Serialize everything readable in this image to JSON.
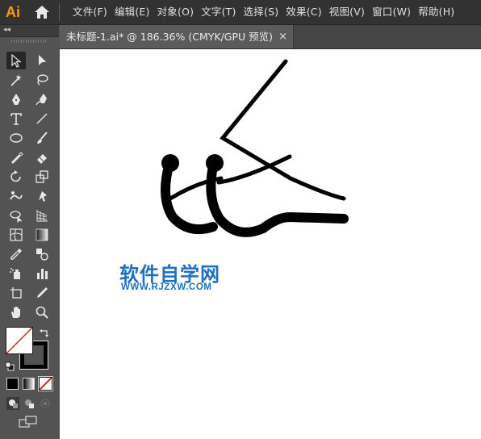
{
  "app": {
    "logo_text": "Ai"
  },
  "menu": {
    "items": [
      "文件(F)",
      "编辑(E)",
      "对象(O)",
      "文字(T)",
      "选择(S)",
      "效果(C)",
      "视图(V)",
      "窗口(W)",
      "帮助(H)"
    ]
  },
  "tab": {
    "title": "未标题-1.ai* @ 186.36% (CMYK/GPU 预览)",
    "close_glyph": "×"
  },
  "toolbar": {
    "collapse_glyph": "◂◂",
    "tools": [
      "selection-tool",
      "direct-selection-tool",
      "magic-wand-tool",
      "lasso-tool",
      "pen-tool",
      "curvature-tool",
      "type-tool",
      "line-segment-tool",
      "ellipse-tool",
      "paintbrush-tool",
      "shaper-tool",
      "eraser-tool",
      "rotate-tool",
      "scale-tool",
      "puppet-warp-tool",
      "free-transform-tool",
      "shape-builder-tool",
      "perspective-grid-tool",
      "mesh-tool",
      "gradient-tool",
      "eyedropper-tool",
      "blend-tool",
      "symbol-sprayer-tool",
      "column-graph-tool",
      "artboard-tool",
      "slice-tool",
      "hand-tool",
      "zoom-tool"
    ]
  },
  "watermark": {
    "title": "软件自学网",
    "url": "WWW.RJZXW.COM"
  },
  "colors": {
    "accent": "#ff9a00",
    "watermark": "#1c6fc4",
    "canvas": "#ffffff",
    "ui_dark": "#323232",
    "ui_panel": "#535353"
  }
}
